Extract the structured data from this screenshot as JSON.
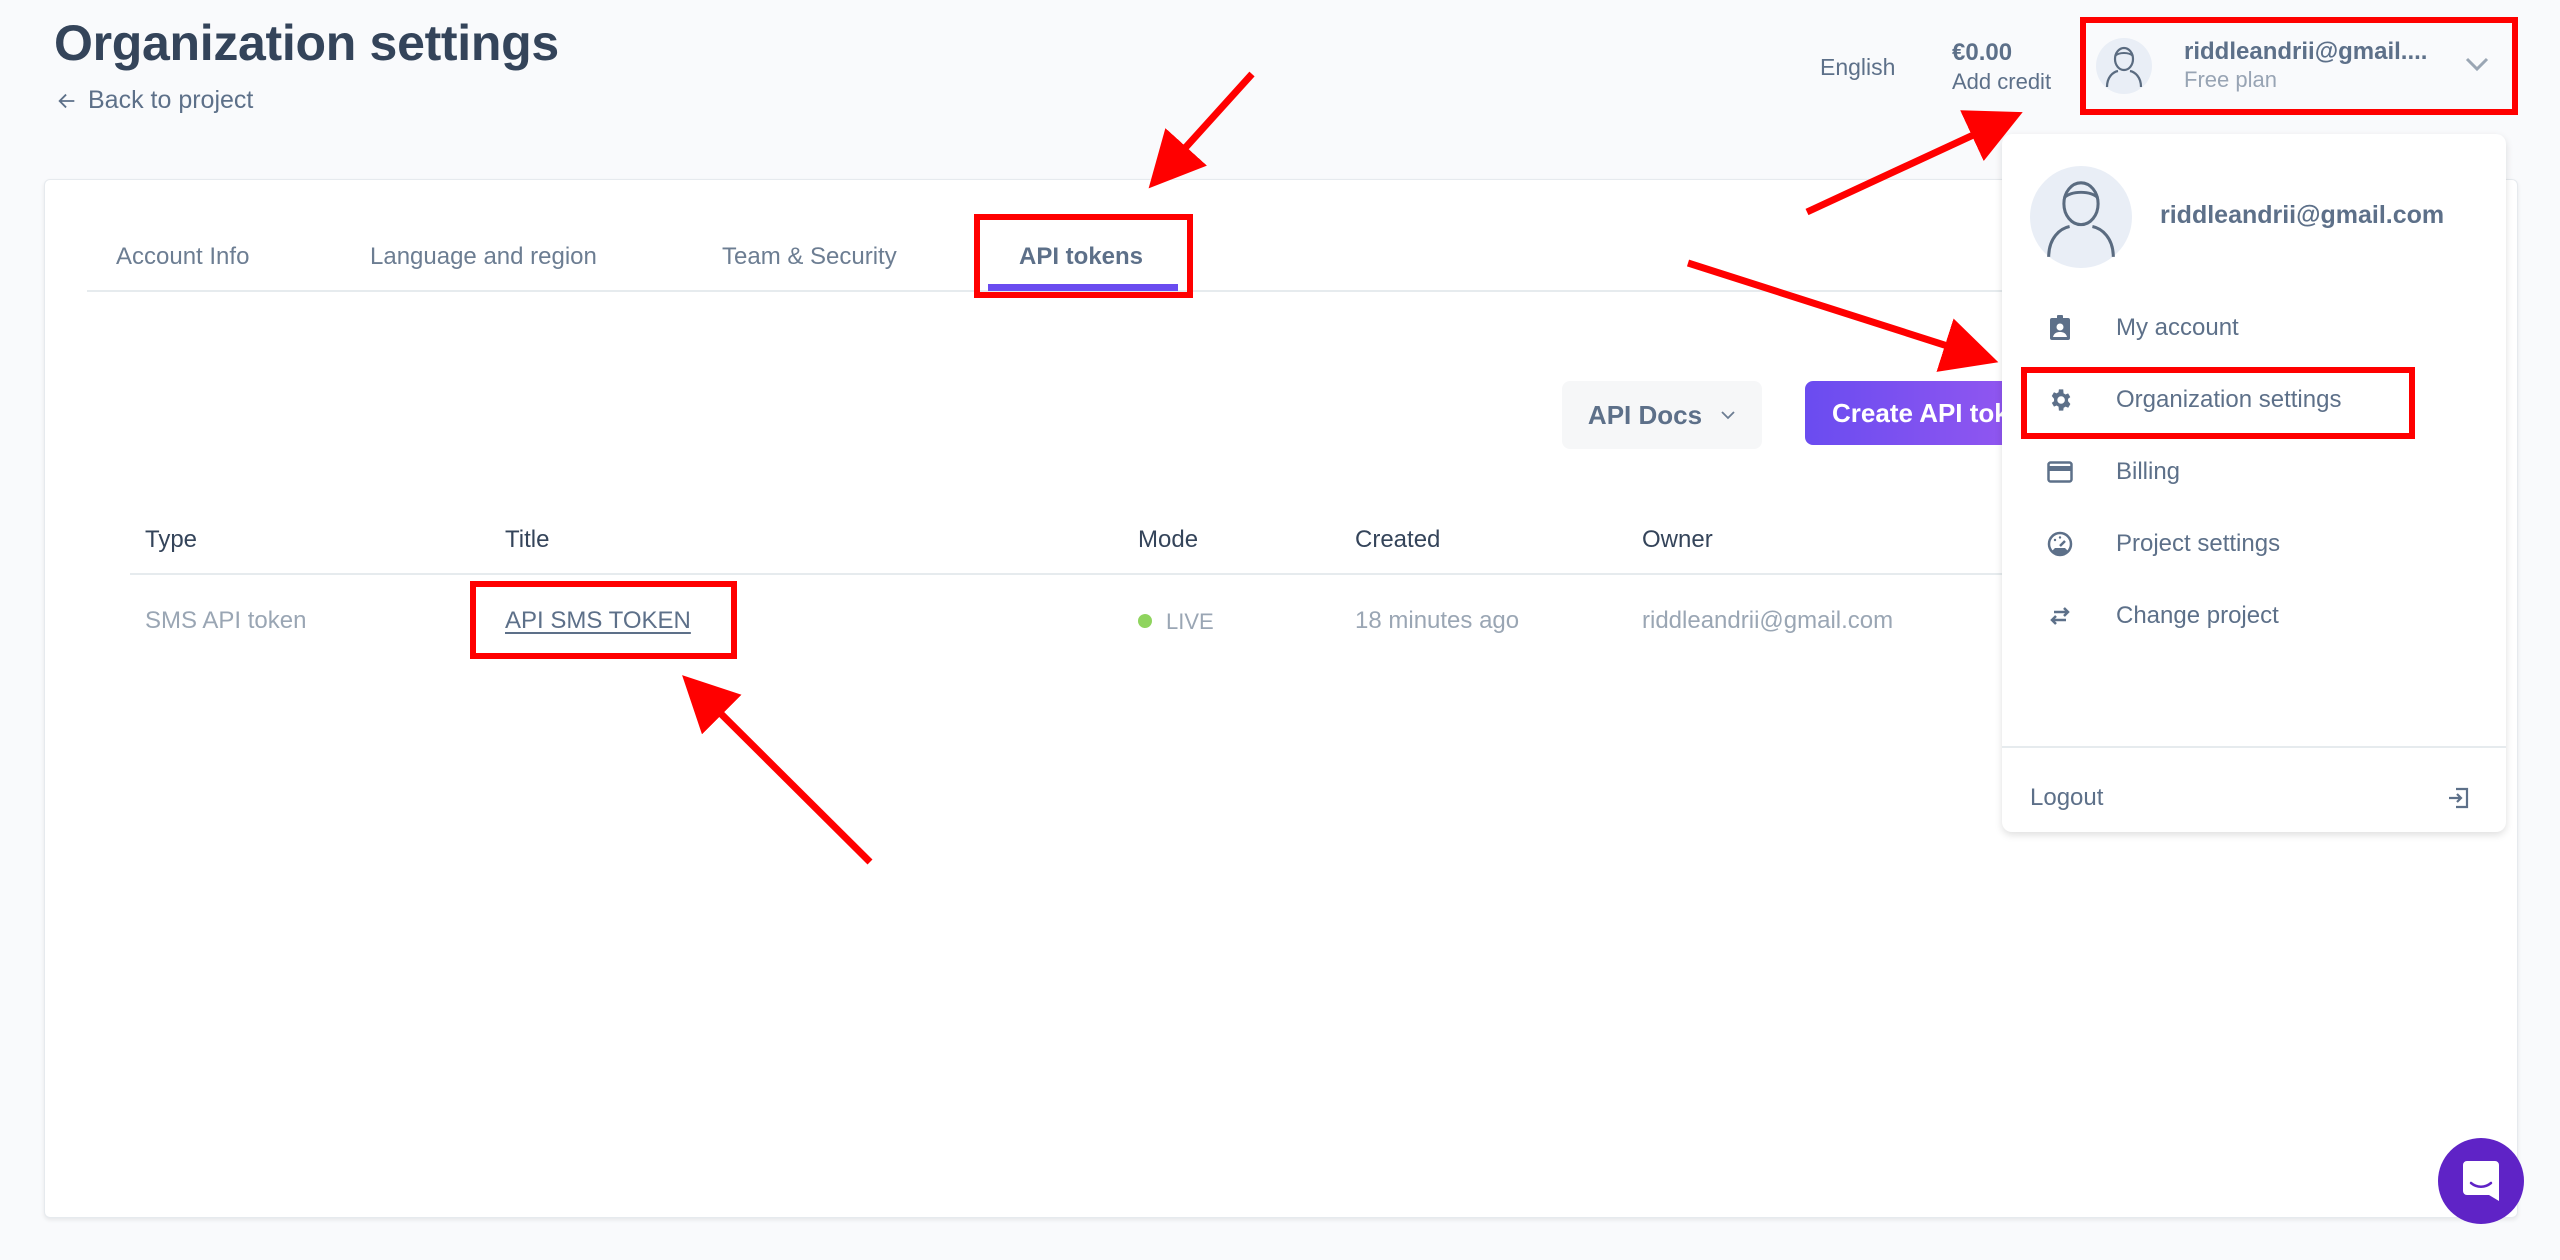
{
  "header": {
    "title": "Organization settings",
    "back_link": "Back to project",
    "language": "English",
    "balance": "€0.00",
    "add_credit": "Add credit",
    "user_email_truncated": "riddleandrii@gmail....",
    "plan": "Free plan"
  },
  "tabs": [
    {
      "label": "Account Info",
      "active": false
    },
    {
      "label": "Language and region",
      "active": false
    },
    {
      "label": "Team & Security",
      "active": false
    },
    {
      "label": "API tokens",
      "active": true
    }
  ],
  "actions": {
    "api_docs": "API Docs",
    "create_token": "Create API token"
  },
  "table": {
    "columns": [
      "Type",
      "Title",
      "Mode",
      "Created",
      "Owner"
    ],
    "rows": [
      {
        "type": "SMS API token",
        "title": "API SMS TOKEN",
        "mode": "LIVE",
        "created": "18 minutes ago",
        "owner": "riddleandrii@gmail.com"
      }
    ]
  },
  "user_menu": {
    "email": "riddleandrii@gmail.com",
    "items": [
      {
        "label": "My account",
        "icon": "account-badge-icon"
      },
      {
        "label": "Organization settings",
        "icon": "gear-icon"
      },
      {
        "label": "Billing",
        "icon": "credit-card-icon"
      },
      {
        "label": "Project settings",
        "icon": "speedometer-icon"
      },
      {
        "label": "Change project",
        "icon": "swap-arrows-icon"
      }
    ],
    "logout": "Logout"
  },
  "colors": {
    "accent": "#6a4cf0",
    "annotation": "#ff0000",
    "live": "#8fd45e",
    "chat": "#5f23c6"
  }
}
